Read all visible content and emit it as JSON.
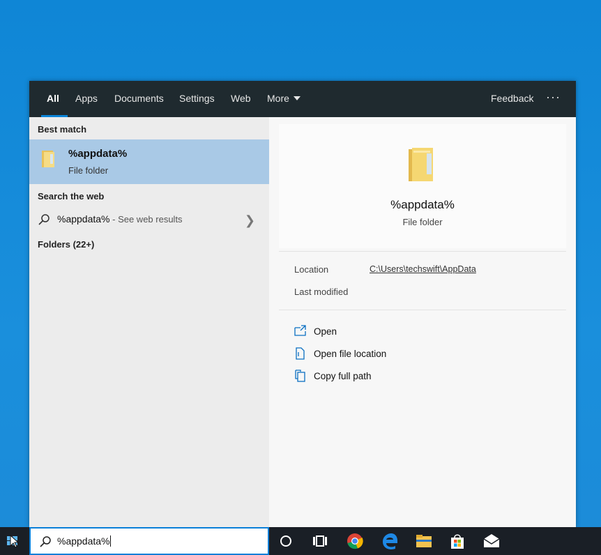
{
  "tabs": [
    {
      "label": "All",
      "active": true
    },
    {
      "label": "Apps"
    },
    {
      "label": "Documents"
    },
    {
      "label": "Settings"
    },
    {
      "label": "Web"
    },
    {
      "label": "More"
    }
  ],
  "feedback_label": "Feedback",
  "more_options_label": "···",
  "left": {
    "best_match_heading": "Best match",
    "best_match": {
      "title": "%appdata%",
      "subtitle": "File folder"
    },
    "search_web_heading": "Search the web",
    "web_result": {
      "query": "%appdata%",
      "suffix": " - See web results"
    },
    "folders_heading": "Folders (22+)"
  },
  "right": {
    "title": "%appdata%",
    "subtitle": "File folder",
    "location_label": "Location",
    "location_value": "C:\\Users\\techswift\\AppData",
    "modified_label": "Last modified",
    "actions": [
      {
        "label": "Open",
        "icon": "open-icon"
      },
      {
        "label": "Open file location",
        "icon": "file-location-icon"
      },
      {
        "label": "Copy full path",
        "icon": "copy-icon"
      }
    ]
  },
  "taskbar": {
    "search_value": "%appdata%",
    "icons": [
      "cortana-icon",
      "task-view-icon",
      "chrome-icon",
      "edge-icon",
      "file-explorer-icon",
      "store-icon",
      "mail-icon"
    ]
  },
  "colors": {
    "accent": "#0a84d8",
    "selection": "#a9c9e6",
    "topbar": "#1f2a2f",
    "taskbar": "#1a1f26"
  }
}
